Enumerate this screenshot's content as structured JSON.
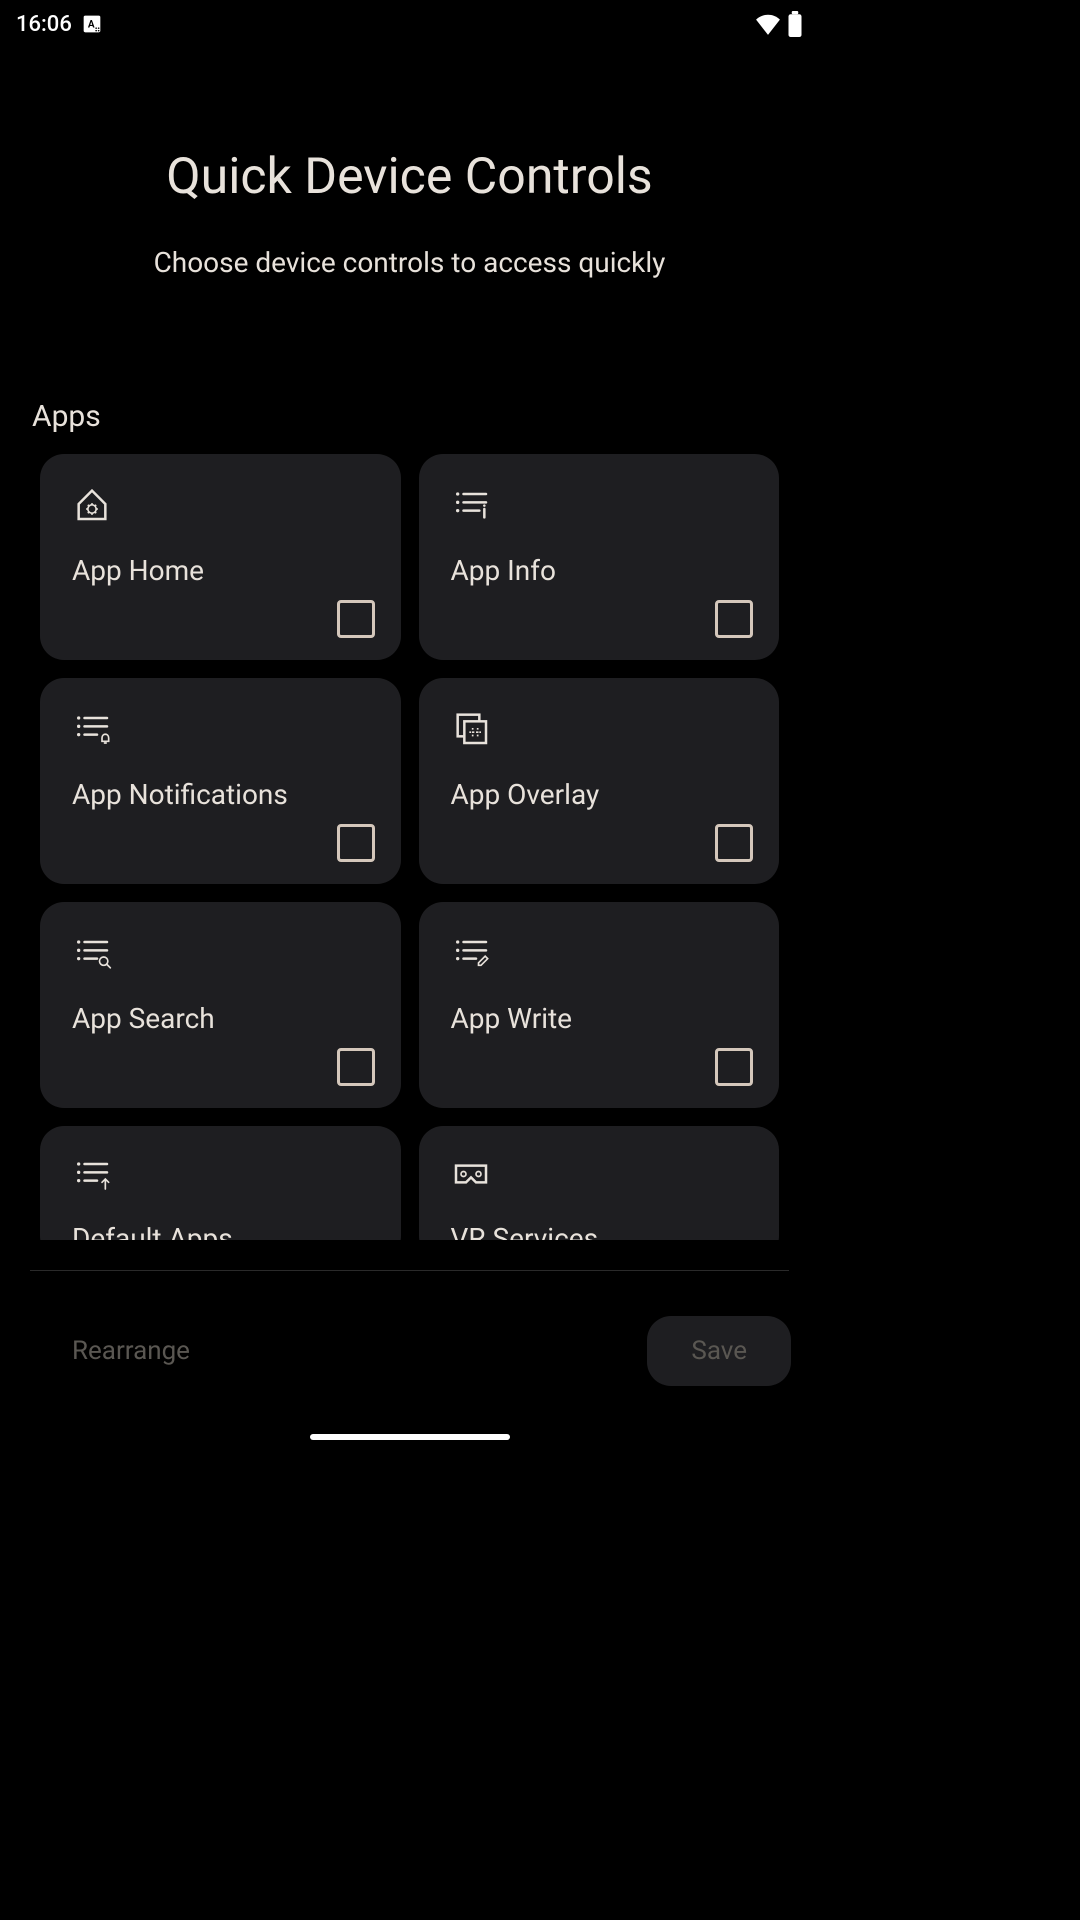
{
  "status": {
    "time": "16:06"
  },
  "header": {
    "title": "Quick Device Controls",
    "subtitle": "Choose device controls to access quickly"
  },
  "section": {
    "label": "Apps"
  },
  "cards": [
    {
      "label": "App Home"
    },
    {
      "label": "App Info"
    },
    {
      "label": "App Notifications"
    },
    {
      "label": "App Overlay"
    },
    {
      "label": "App Search"
    },
    {
      "label": "App Write"
    },
    {
      "label": "Default Apps"
    },
    {
      "label": "VR Services"
    }
  ],
  "footer": {
    "rearrange": "Rearrange",
    "save": "Save"
  }
}
